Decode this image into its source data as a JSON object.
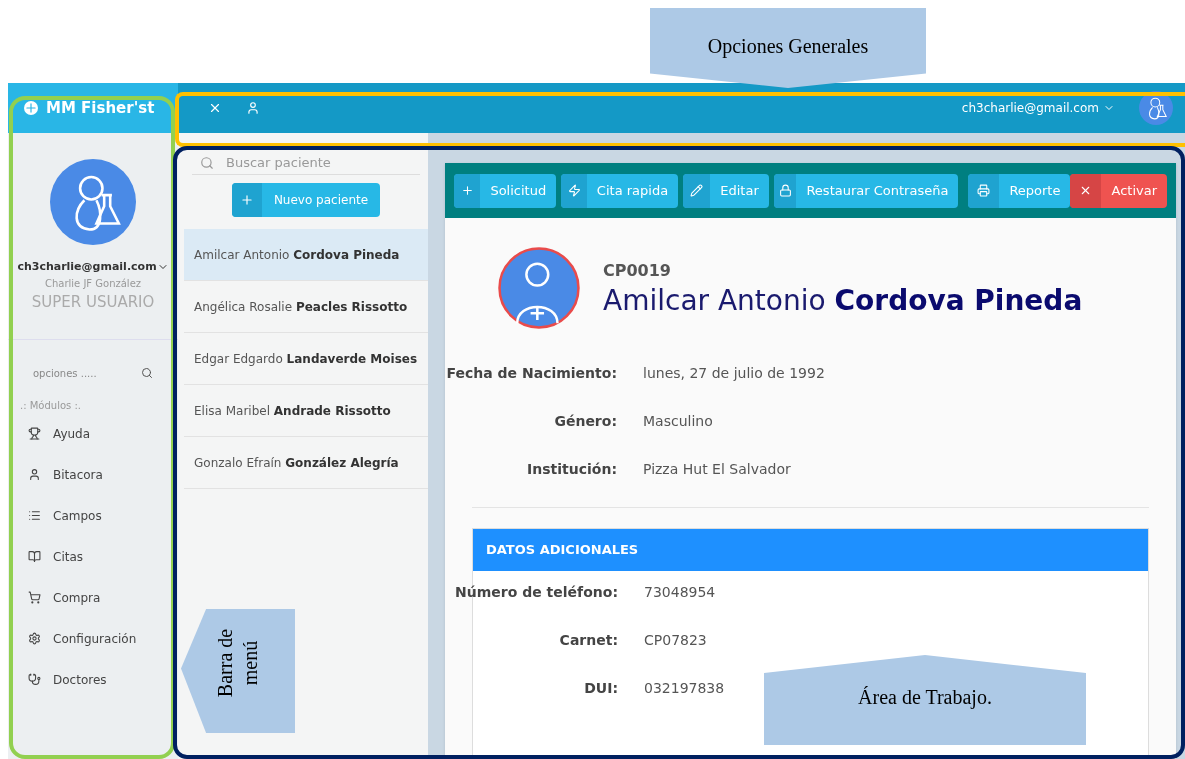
{
  "annotations": [
    {
      "kind": "top",
      "lines": [
        "Opciones Generales"
      ]
    },
    {
      "kind": "left",
      "lines": [
        "Barra de",
        "menú"
      ]
    },
    {
      "kind": "bottom",
      "lines": [
        "Área de Trabajo."
      ]
    }
  ],
  "sidebar": {
    "brand": "MM Fisher'st",
    "email": "ch3charlie@gmail.com",
    "name": "Charlie JF González",
    "role": "SUPER USUARIO",
    "search_placeholder": "opciones .....",
    "section": ".: Módulos :.",
    "items": [
      {
        "kind": "trophy",
        "label": "Ayuda"
      },
      {
        "kind": "user",
        "label": "Bitacora"
      },
      {
        "kind": "list",
        "label": "Campos"
      },
      {
        "kind": "book",
        "label": "Citas"
      },
      {
        "kind": "cart",
        "label": "Compra"
      },
      {
        "kind": "gear",
        "label": "Configuración"
      },
      {
        "kind": "stethoscope",
        "label": "Doctores"
      }
    ]
  },
  "topbar": {
    "email": "ch3charlie@gmail.com"
  },
  "patients": {
    "search_placeholder": "Buscar paciente",
    "new_button": "Nuevo paciente",
    "rows": [
      {
        "first": "Amilcar Antonio",
        "last": "Cordova Pineda",
        "selected": true
      },
      {
        "first": "Angélica Rosalie",
        "last": "Peacles Rissotto",
        "selected": false
      },
      {
        "first": "Edgar Edgardo",
        "last": "Landaverde Moises",
        "selected": false
      },
      {
        "first": "Elisa Maribel",
        "last": "Andrade Rissotto",
        "selected": false
      },
      {
        "first": "Gonzalo Efraín",
        "last": "González Alegría",
        "selected": false
      }
    ]
  },
  "toolbar": {
    "left": [
      {
        "kind": "plus",
        "label": "Solicitud"
      },
      {
        "kind": "bolt",
        "label": "Cita rapida"
      },
      {
        "kind": "pencil",
        "label": "Editar"
      },
      {
        "kind": "lock",
        "label": "Restaurar Contraseña"
      }
    ],
    "right": [
      {
        "kind": "print",
        "label": "Reporte"
      },
      {
        "kind": "activate",
        "label": "Activar"
      }
    ]
  },
  "profile": {
    "code": "CP0019",
    "first": "Amilcar Antonio",
    "last": "Cordova Pineda",
    "fields": [
      {
        "label": "Fecha de Nacimiento:",
        "value": "lunes, 27 de julio de 1992"
      },
      {
        "label": "Género:",
        "value": "Masculino"
      },
      {
        "label": "Institución:",
        "value": "Pizza Hut El Salvador"
      }
    ],
    "section": "DATOS ADICIONALES",
    "extra_fields": [
      {
        "label": "Número de teléfono:",
        "value": "73048954"
      },
      {
        "label": "Carnet:",
        "value": "CP07823"
      },
      {
        "label": "DUI:",
        "value": "032197838"
      }
    ]
  }
}
